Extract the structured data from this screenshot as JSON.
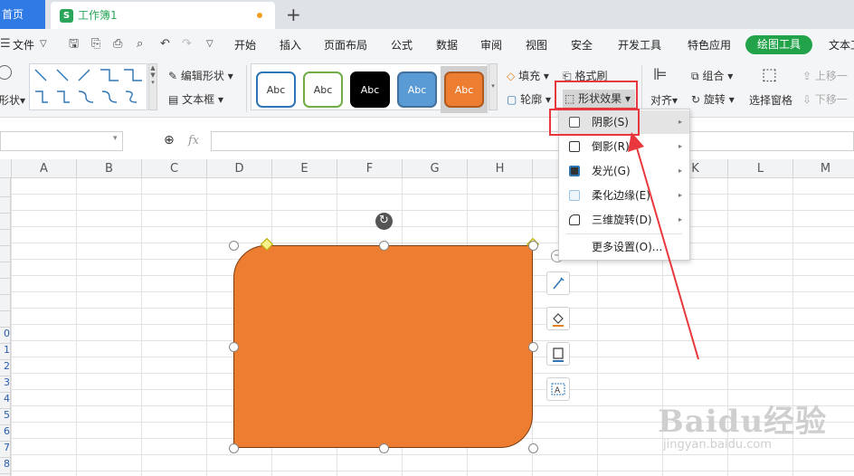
{
  "tabs": {
    "home": "首页",
    "workbook": "工作簿1",
    "workbook_logo": "S",
    "add": "+"
  },
  "menu": {
    "file": "文件",
    "items": [
      "开始",
      "插入",
      "页面布局",
      "公式",
      "数据",
      "审阅",
      "视图",
      "安全",
      "开发工具",
      "特色应用"
    ],
    "active": "绘图工具",
    "text_tools": "文本工"
  },
  "ribbon": {
    "shape_label": "形状",
    "edit_shape": "编辑形状",
    "text_box": "文本框",
    "styles": [
      {
        "label": "Abc",
        "bg": "#ffffff",
        "border": "#2e75b6",
        "color": "#333333"
      },
      {
        "label": "Abc",
        "bg": "#ffffff",
        "border": "#70ad47",
        "color": "#333333"
      },
      {
        "label": "Abc",
        "bg": "#000000",
        "border": "#000000",
        "color": "#ffffff"
      },
      {
        "label": "Abc",
        "bg": "#5b9bd5",
        "border": "#41719c",
        "color": "#ffffff"
      },
      {
        "label": "Abc",
        "bg": "#ed7d31",
        "border": "#ae5a21",
        "color": "#ffffff"
      }
    ],
    "fill": "填充",
    "format_painter": "格式刷",
    "outline": "轮廓",
    "shape_effects": "形状效果",
    "align": "对齐",
    "group": "组合",
    "rotate": "旋转",
    "selection_pane": "选择窗格",
    "bring_forward": "上移一",
    "send_backward": "下移一"
  },
  "formula": {
    "fx": "fx"
  },
  "columns": [
    "A",
    "B",
    "C",
    "D",
    "E",
    "F",
    "G",
    "H",
    "I",
    "J",
    "K",
    "L",
    "M"
  ],
  "rows": [
    "",
    "",
    "",
    "",
    "",
    "",
    "",
    "",
    "",
    "0",
    "1",
    "2",
    "3",
    "4",
    "5",
    "6",
    "7",
    "8"
  ],
  "dropdown": {
    "items": [
      {
        "label": "阴影(S)",
        "has_submenu": true
      },
      {
        "label": "倒影(R)",
        "has_submenu": true
      },
      {
        "label": "发光(G)",
        "has_submenu": true
      },
      {
        "label": "柔化边缘(E)",
        "has_submenu": true
      },
      {
        "label": "三维旋转(D)",
        "has_submenu": true
      },
      {
        "label": "更多设置(O)...",
        "has_submenu": false
      }
    ]
  },
  "shape": {
    "fill": "#ed7d31"
  },
  "watermark": {
    "main": "Baidu经验",
    "sub": "jingyan.baidu.com"
  }
}
